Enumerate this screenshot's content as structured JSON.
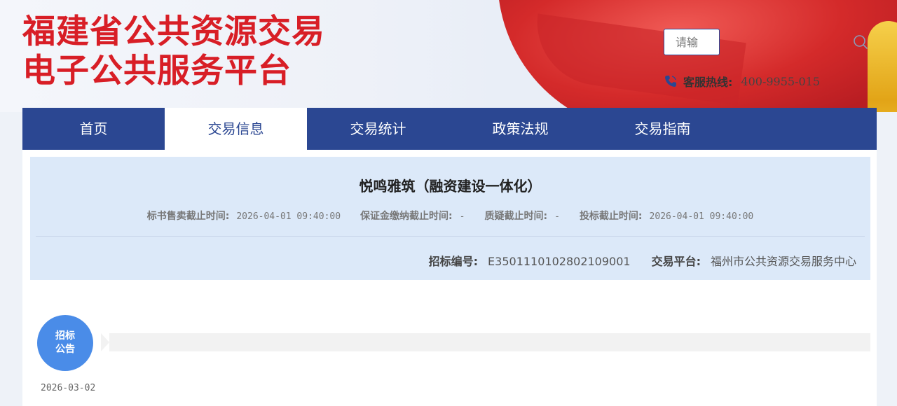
{
  "header": {
    "logo_line1": "福建省公共资源交易",
    "logo_line2": "电子公共服务平台",
    "search_placeholder": "请输",
    "hotline_label": "客服热线:",
    "hotline_number": "400-9955-015"
  },
  "nav": {
    "items": [
      {
        "label": "首页"
      },
      {
        "label": "交易信息",
        "active": true
      },
      {
        "label": "交易统计"
      },
      {
        "label": "政策法规"
      },
      {
        "label": "交易指南"
      }
    ]
  },
  "project": {
    "title": "悦鸣雅筑（融资建设一体化）",
    "deadlines": [
      {
        "label": "标书售卖截止时间:",
        "value": "2026-04-01 09:40:00"
      },
      {
        "label": "保证金缴纳截止时间:",
        "value": "-"
      },
      {
        "label": "质疑截止时间:",
        "value": "-"
      },
      {
        "label": "投标截止时间:",
        "value": "2026-04-01 09:40:00"
      }
    ],
    "bid_no_label": "招标编号:",
    "bid_no": "E3501110102802109001",
    "platform_label": "交易平台:",
    "platform": "福州市公共资源交易服务中心"
  },
  "timeline": {
    "stage_line1": "招标",
    "stage_line2": "公告",
    "date": "2026-03-02"
  },
  "colors": {
    "nav_bg": "#2b4792",
    "logo_red": "#d81e26",
    "card_bg": "#dce9f9",
    "bubble_blue": "#4a8ce8"
  }
}
